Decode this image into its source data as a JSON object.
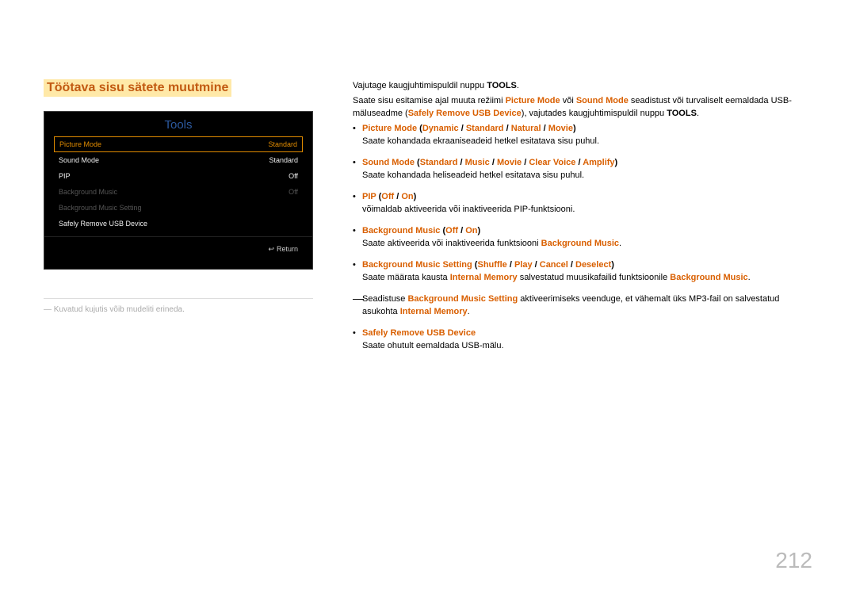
{
  "heading": "Töötava sisu sätete muutmine",
  "tools_panel": {
    "title": "Tools",
    "rows": [
      {
        "label": "Picture Mode",
        "value": "Standard",
        "state": "selected"
      },
      {
        "label": "Sound Mode",
        "value": "Standard",
        "state": "normal"
      },
      {
        "label": "PIP",
        "value": "Off",
        "state": "normal"
      },
      {
        "label": "Background Music",
        "value": "Off",
        "state": "dim"
      },
      {
        "label": "Background Music Setting",
        "value": "",
        "state": "dim"
      },
      {
        "label": "Safely Remove USB Device",
        "value": "",
        "state": "normal"
      }
    ],
    "return_label": "Return"
  },
  "img_note": "Kuvatud kujutis võib mudeliti erineda.",
  "intro": {
    "line1_a": "Vajutage kaugjuhtimispuldil nuppu ",
    "line1_b": "TOOLS",
    "line1_c": ".",
    "line2_a": "Saate sisu esitamise ajal muuta režiimi ",
    "pm": "Picture Mode",
    "or": " või ",
    "sm": "Sound Mode",
    "line2_b": " seadistust või turvaliselt eemaldada USB-mäluseadme (",
    "srud": "Safely Remove USB Device",
    "line2_c": "), vajutades kaugjuhtimispuldil nuppu ",
    "tools2": "TOOLS",
    "line2_d": "."
  },
  "bullets": {
    "b1": {
      "name": "Picture Mode",
      "paren_open": " (",
      "o1": "Dynamic",
      "s1": " / ",
      "o2": "Standard",
      "s2": " / ",
      "o3": "Natural",
      "s3": " / ",
      "o4": "Movie",
      "paren_close": ")",
      "desc": "Saate kohandada ekraaniseadeid hetkel esitatava sisu puhul."
    },
    "b2": {
      "name": "Sound Mode",
      "paren_open": " (",
      "o1": "Standard",
      "s1": " / ",
      "o2": "Music",
      "s2": " / ",
      "o3": "Movie",
      "s3": " / ",
      "o4": "Clear Voice",
      "s4": " / ",
      "o5": "Amplify",
      "paren_close": ")",
      "desc": "Saate kohandada heliseadeid hetkel esitatava sisu puhul."
    },
    "b3": {
      "name": "PIP",
      "paren_open": " (",
      "o1": "Off",
      "s1": " / ",
      "o2": "On",
      "paren_close": ")",
      "desc": "võimaldab aktiveerida või inaktiveerida PIP-funktsiooni."
    },
    "b4": {
      "name": "Background Music",
      "paren_open": " (",
      "o1": "Off",
      "s1": " / ",
      "o2": "On",
      "paren_close": ")",
      "desc_a": "Saate aktiveerida või inaktiveerida funktsiooni ",
      "desc_b": "Background Music",
      "desc_c": "."
    },
    "b5": {
      "name": "Background Music Setting",
      "paren_open": " (",
      "o1": "Shuffle",
      "s1": " / ",
      "o2": "Play",
      "s2": " / ",
      "o3": "Cancel",
      "s3": " / ",
      "o4": "Deselect",
      "paren_close": ")",
      "desc_a": "Saate määrata kausta ",
      "desc_b": "Internal Memory",
      "desc_c": " salvestatud muusikafailid funktsioonile ",
      "desc_d": "Background Music",
      "desc_e": "."
    },
    "sub": {
      "a": "Seadistuse ",
      "b": "Background Music Setting",
      "c": " aktiveerimiseks veenduge, et vähemalt üks MP3-fail on salvestatud asukohta ",
      "d": "Internal Memory",
      "e": "."
    },
    "b6": {
      "name": "Safely Remove USB Device",
      "desc": "Saate ohutult eemaldada USB-mälu."
    }
  },
  "page_number": "212"
}
